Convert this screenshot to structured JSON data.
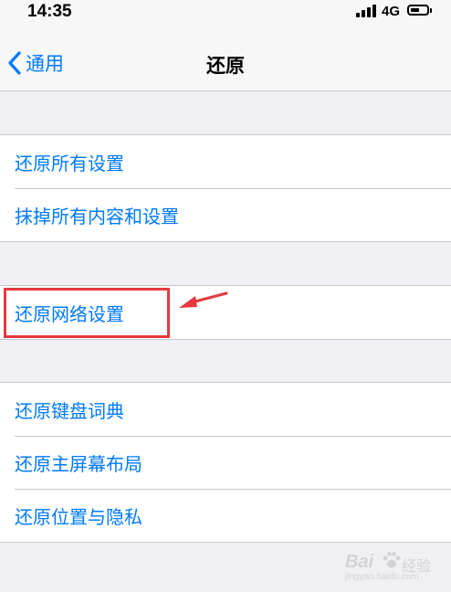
{
  "status_bar": {
    "time": "14:35",
    "network": "4G",
    "battery_level": 0.55,
    "icons": [
      "signal-icon",
      "battery-icon"
    ]
  },
  "nav": {
    "back_label": "通用",
    "title": "还原",
    "back_icon": "chevron-left-icon"
  },
  "groups": [
    {
      "items": [
        "还原所有设置",
        "抹掉所有内容和设置"
      ]
    },
    {
      "items": [
        "还原网络设置"
      ]
    },
    {
      "items": [
        "还原键盘词典",
        "还原主屏幕布局",
        "还原位置与隐私"
      ]
    }
  ],
  "annotation": {
    "highlighted_item": "还原网络设置",
    "color": "#e8383d"
  },
  "watermark": {
    "brand": "Bai",
    "brand_suffix": "经验",
    "url": "jingyan.baidu.com"
  },
  "colors": {
    "accent": "#007aff",
    "background": "#efeff4",
    "separator": "#c8c7cc"
  }
}
